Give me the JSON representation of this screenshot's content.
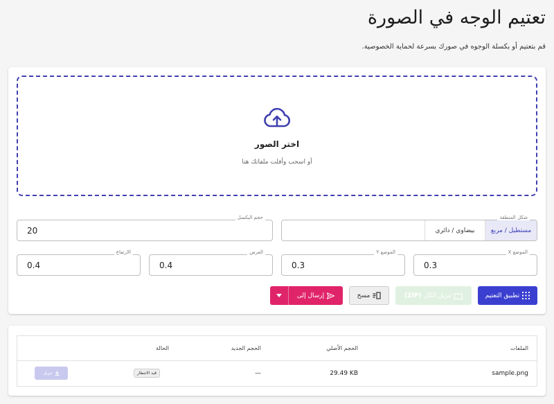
{
  "header": {
    "title": "تعتيم الوجه في الصورة",
    "description": "قم بتعتيم أو بكسلة الوجوه في صورك بسرعة لحماية الخصوصية."
  },
  "dropzone": {
    "title": "اختر الصور",
    "subtitle": "أو اسحب وأفلت ملفاتك هنا"
  },
  "settings": {
    "shape": {
      "label": "شكل المنطقة",
      "options": [
        "مستطيل / مربع",
        "بيضاوي / دائري"
      ],
      "selected": "مستطيل / مربع"
    },
    "pixel_size": {
      "label": "حجم البكسل",
      "value": "20"
    },
    "pos_x": {
      "label": "الموضع X",
      "value": "0.3"
    },
    "pos_y": {
      "label": "الموضع Y",
      "value": "0.3"
    },
    "width": {
      "label": "العرض",
      "value": "0.4"
    },
    "height": {
      "label": "الارتفاع",
      "value": "0.4"
    }
  },
  "actions": {
    "apply": "تطبيق التعتيم",
    "download_all": "تنزيل الكل",
    "download_zip": "(ZIP)",
    "clear": "مسح",
    "send_to": "إرسال إلى"
  },
  "files_table": {
    "columns": [
      "الملفات",
      "الحجم الأصلي",
      "الحجم الجديد",
      "الحالة"
    ],
    "rows": [
      {
        "name": "sample.png",
        "original_size": "29.49 KB",
        "new_size": "—",
        "status": "قيد الانتظار",
        "action": "تنزيل"
      }
    ]
  },
  "icons": {
    "upload": "cloud-upload-icon",
    "apply": "grid-icon",
    "download_all": "folder-zip-icon",
    "clear": "clear-icon",
    "send": "send-icon",
    "dropdown": "chevron-down-icon",
    "row_download": "download-icon"
  },
  "colors": {
    "primary": "#3b3fd0",
    "accent": "#e0246a",
    "disabled_green": "#e1f1e1",
    "dropzone_border": "#3f3fb0"
  }
}
